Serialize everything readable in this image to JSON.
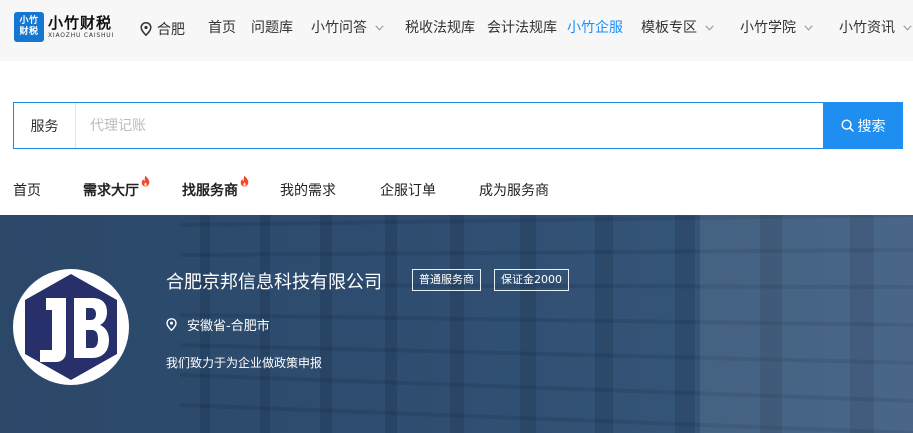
{
  "header": {
    "logo": {
      "badge_line1": "小竹",
      "badge_line2": "财税",
      "name": "小竹财税",
      "name_en": "XIAOZHU CAISHUI"
    },
    "city": "合肥",
    "nav": [
      {
        "label": "首页"
      },
      {
        "label": "问题库"
      },
      {
        "label": "小竹问答"
      },
      {
        "label": "税收法规库"
      },
      {
        "label": "会计法规库"
      },
      {
        "label": "小竹企服"
      },
      {
        "label": "模板专区"
      },
      {
        "label": "小竹学院"
      },
      {
        "label": "小竹资讯"
      }
    ],
    "active_nav": "小竹企服"
  },
  "search": {
    "category": "服务",
    "placeholder": "代理记账",
    "button_label": "搜索"
  },
  "subnav": [
    {
      "label": "首页"
    },
    {
      "label": "需求大厅"
    },
    {
      "label": "找服务商"
    },
    {
      "label": "我的需求"
    },
    {
      "label": "企服订单"
    },
    {
      "label": "成为服务商"
    }
  ],
  "company": {
    "name": "合肥京邦信息科技有限公司",
    "badges": [
      "普通服务商",
      "保证金2000"
    ],
    "location": "安徽省-合肥市",
    "description": "我们致力于为企业做政策申报"
  },
  "colors": {
    "accent": "#1890ff",
    "search_button": "#1e8ef0",
    "banner_bg": "#2a4566",
    "logo_navy": "#27306b",
    "fire": "#f5462d"
  }
}
